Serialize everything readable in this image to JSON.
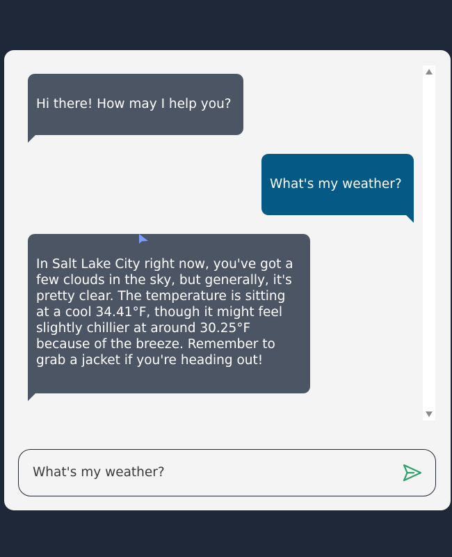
{
  "messages": [
    {
      "role": "assistant",
      "text": "Hi there! How may I help you?"
    },
    {
      "role": "user",
      "text": "What's my weather?"
    },
    {
      "role": "assistant",
      "text": "In Salt Lake City right now, you've got a few clouds in the sky, but generally, it's pretty clear. The temperature is sitting at a cool 34.41°F, though it might feel slightly chillier at around 30.25°F because of the breeze. Remember to grab a jacket if you're heading out!"
    }
  ],
  "input": {
    "value": "What's my weather?"
  },
  "icons": {
    "send": "send-icon",
    "scroll_up": "triangle-up-icon",
    "scroll_down": "triangle-down-icon",
    "cursor": "mouse-pointer-icon"
  },
  "colors": {
    "page_background": "#1f2838",
    "card_background": "#f4f4f4",
    "assistant_bubble": "#4c5564",
    "user_bubble": "#045a85",
    "send_icon": "#2e9e6e"
  }
}
